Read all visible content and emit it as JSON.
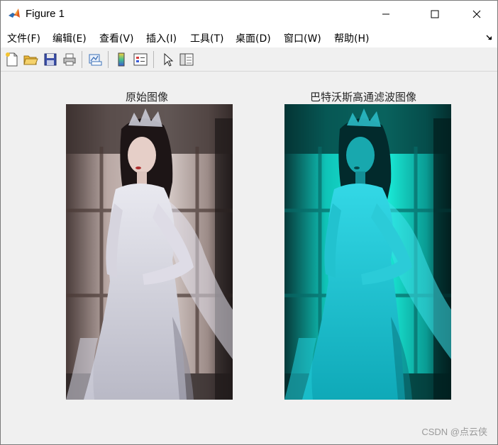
{
  "window": {
    "title": "Figure 1"
  },
  "menu": {
    "items": [
      {
        "label": "文件(F)"
      },
      {
        "label": "编辑(E)"
      },
      {
        "label": "查看(V)"
      },
      {
        "label": "插入(I)"
      },
      {
        "label": "工具(T)"
      },
      {
        "label": "桌面(D)"
      },
      {
        "label": "窗口(W)"
      },
      {
        "label": "帮助(H)"
      }
    ]
  },
  "toolbar": {
    "buttons": [
      "new-figure-icon",
      "open-file-icon",
      "save-icon",
      "print-icon",
      "link-plot-icon",
      "colorbar-icon",
      "legend-icon",
      "select-pointer-icon",
      "property-inspector-icon"
    ]
  },
  "figure": {
    "left_axes_title": "原始图像",
    "right_axes_title": "巴特沃斯高通滤波图像"
  },
  "watermark": "CSDN @点云侠",
  "colors": {
    "window_bg": "#f0f0f0",
    "original_tone": "#d9d4dc",
    "filtered_tone": "#19d9d4"
  }
}
